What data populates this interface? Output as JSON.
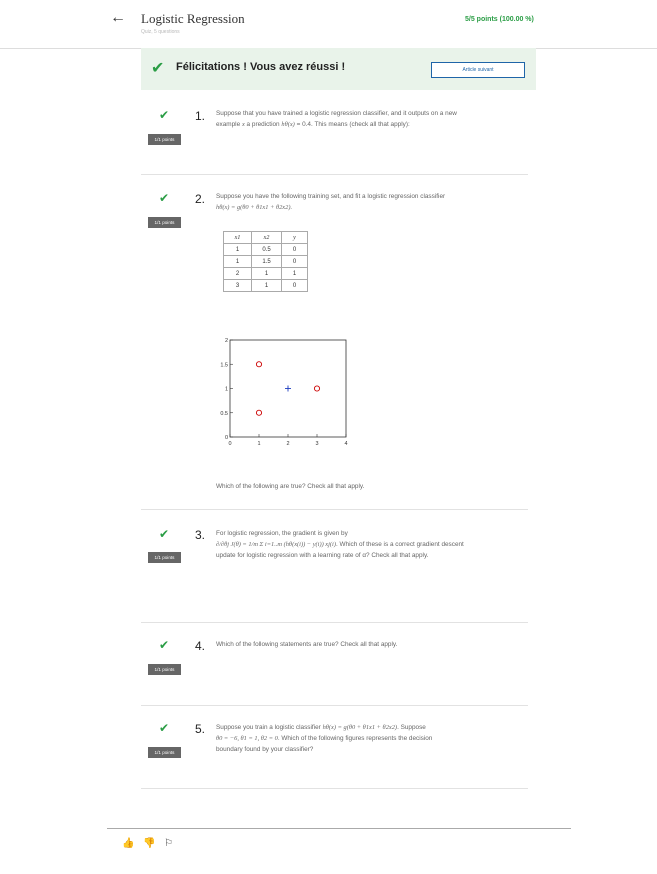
{
  "header": {
    "back_glyph": "←",
    "title": "Logistic Regression",
    "subtitle": "Quiz, 5 questions",
    "score": "5/5 points (100.00 %)"
  },
  "banner": {
    "text": "Félicitations ! Vous avez réussi !",
    "next_label": "Article suivant"
  },
  "questions": [
    {
      "number": "1.",
      "badge": "1/1 points",
      "line1": "Suppose that you have trained a logistic regression classifier, and it outputs on a new",
      "line2_a": "example ",
      "line2_x": "x",
      "line2_b": " a prediction ",
      "line2_h": "hθ(x)",
      "line2_c": " = 0.4. This means (check all that apply):"
    },
    {
      "number": "2.",
      "badge": "1/1 points",
      "line1": "Suppose you have the following training set, and fit a logistic regression classifier",
      "line2": "hθ(x) = g(θ0 + θ1x1 + θ2x2).",
      "table": {
        "headers": [
          "x1",
          "x2",
          "y"
        ],
        "rows": [
          [
            "1",
            "0.5",
            "0"
          ],
          [
            "1",
            "1.5",
            "0"
          ],
          [
            "2",
            "1",
            "1"
          ],
          [
            "3",
            "1",
            "0"
          ]
        ]
      },
      "after": "Which of the following are true? Check all that apply."
    },
    {
      "number": "3.",
      "badge": "1/1 points",
      "line1": "For logistic regression, the gradient is given by",
      "line2_math": "∂/∂θj J(θ) = 1/m Σ i=1..m (hθ(x(i)) − y(i)) xj(i)",
      "line2_rest": ". Which of these is a correct gradient descent",
      "line3": "update for logistic regression with a learning rate of α? Check all that apply."
    },
    {
      "number": "4.",
      "badge": "1/1 points",
      "line1": "Which of the following statements are true? Check all that apply."
    },
    {
      "number": "5.",
      "badge": "1/1 points",
      "line1_a": "Suppose you train a logistic classifier ",
      "line1_math": "hθ(x) = g(θ0 + θ1x1 + θ2x2)",
      "line1_b": ". Suppose",
      "line2_math": "θ0 = −6, θ1 = 1, θ2 = 0",
      "line2_rest": ". Which of the following figures represents the decision",
      "line3": "boundary found by your classifier?"
    }
  ],
  "chart_data": {
    "type": "scatter",
    "xlim": [
      0,
      4
    ],
    "ylim": [
      0,
      2
    ],
    "x_ticks": [
      "0",
      "1",
      "2",
      "3",
      "4"
    ],
    "y_ticks": [
      "0",
      "0.5",
      "1",
      "1.5",
      "2"
    ],
    "series": [
      {
        "marker": "circle",
        "color": "#cc0000",
        "points": [
          [
            1,
            0.5
          ],
          [
            1,
            1.5
          ],
          [
            3,
            1
          ]
        ]
      },
      {
        "marker": "plus",
        "color": "#1f3fc0",
        "points": [
          [
            2,
            1
          ]
        ]
      }
    ]
  },
  "footer": {
    "like_glyph": "👍",
    "dislike_glyph": "👎",
    "flag_glyph": "⚐"
  }
}
